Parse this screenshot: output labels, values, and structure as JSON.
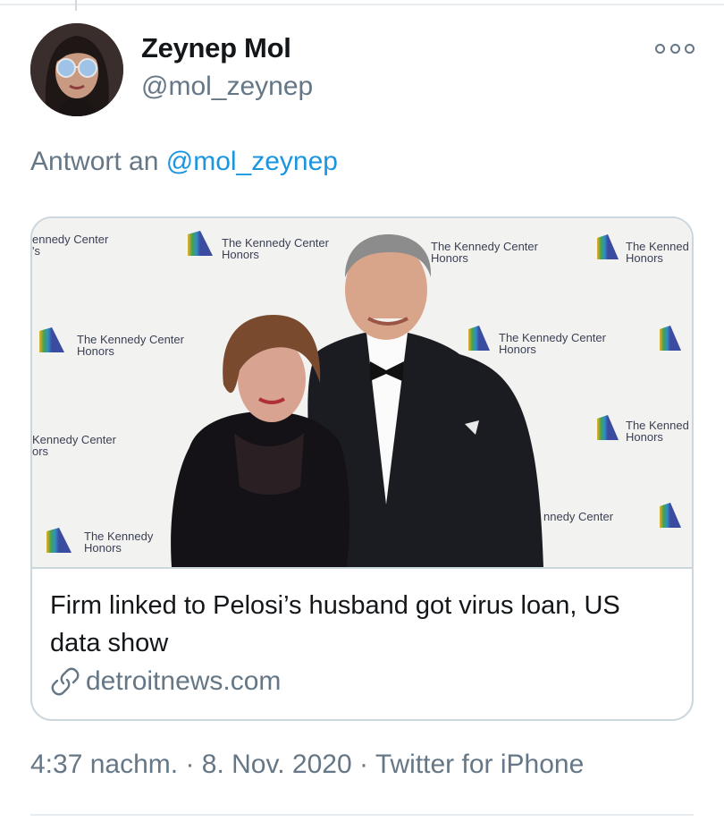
{
  "tweet": {
    "author": {
      "display_name": "Zeynep Mol",
      "handle": "@mol_zeynep"
    },
    "more_icon": "more-options-icon",
    "reply_prefix": "Antwort an",
    "reply_mention": "@mol_zeynep",
    "card": {
      "title": "Firm linked to Pelosi’s husband got virus loan, US data show",
      "domain": "detroitnews.com",
      "link_icon": "link-icon",
      "backdrop_text": {
        "line1": "The Kennedy Center",
        "line2": "Honors"
      }
    },
    "meta": {
      "time": "4:37 nachm.",
      "date": "8. Nov. 2020",
      "source": "Twitter for iPhone"
    }
  },
  "colors": {
    "text_primary": "#14171a",
    "text_secondary": "#657786",
    "link": "#1b95e0",
    "border": "#ccd6dd"
  }
}
